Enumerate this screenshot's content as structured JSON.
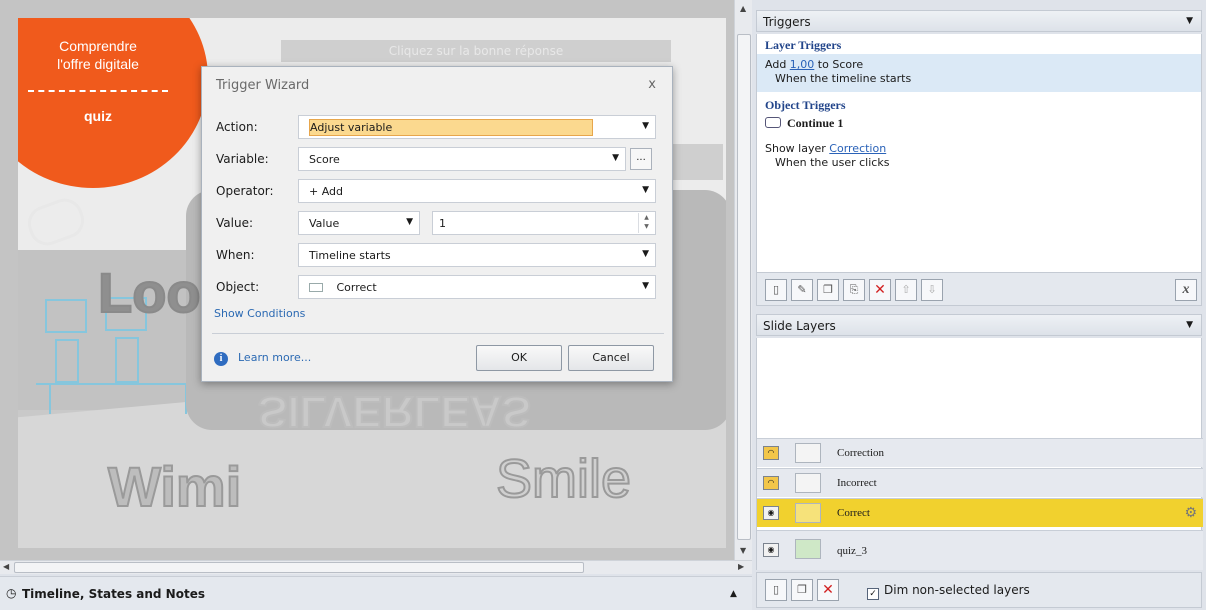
{
  "slide": {
    "orange_line1": "Comprendre",
    "orange_line2": "l'offre digitale",
    "orange_quiz": "quiz",
    "banner": "Cliquez sur la bonne réponse",
    "word_loo": "Loo",
    "word_wimi": "Wimi",
    "word_smile": "Smile",
    "word_silver": "SILVERLEAS"
  },
  "bottom": {
    "timeline_label": "Timeline, States and Notes"
  },
  "dialog": {
    "title": "Trigger Wizard",
    "close": "x",
    "action": {
      "label": "Action:",
      "value": "Adjust variable"
    },
    "variable": {
      "label": "Variable:",
      "value": "Score",
      "ellipsis": "..."
    },
    "operator": {
      "label": "Operator:",
      "value": "+ Add"
    },
    "value": {
      "label": "Value:",
      "type": "Value",
      "number": "1"
    },
    "when": {
      "label": "When:",
      "value": "Timeline starts"
    },
    "object": {
      "label": "Object:",
      "value": "Correct"
    },
    "show_conditions": "Show Conditions",
    "learn_more": "Learn more...",
    "ok": "OK",
    "cancel": "Cancel"
  },
  "triggers": {
    "header": "Triggers",
    "layer_triggers": "Layer Triggers",
    "layer_trigger_prefix": "Add",
    "layer_trigger_value": "1,00",
    "layer_trigger_suffix": "to Score",
    "layer_trigger_when": "When the timeline starts",
    "object_triggers": "Object Triggers",
    "object_name": "Continue 1",
    "object_trigger_prefix": "Show layer",
    "object_trigger_link": "Correction",
    "object_trigger_when": "When the user clicks",
    "variables_button": "x"
  },
  "layers": {
    "header": "Slide Layers",
    "items": [
      {
        "name": "Correction"
      },
      {
        "name": "Incorrect"
      },
      {
        "name": "Correct"
      },
      {
        "name": "quiz_3"
      }
    ],
    "dim_label": "Dim non-selected layers"
  },
  "colors": {
    "accent_orange": "#f05a1c",
    "selected_layer": "#f1d12e",
    "link_blue": "#2a62b8"
  }
}
